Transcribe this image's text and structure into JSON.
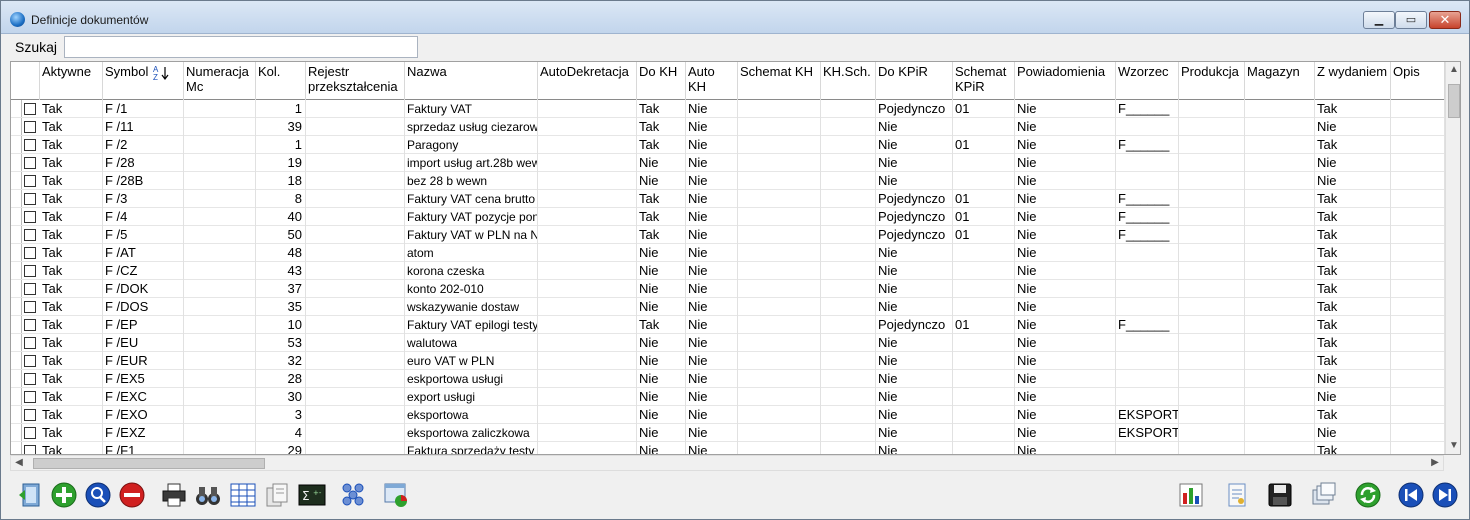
{
  "window": {
    "title": "Definicje dokumentów"
  },
  "search": {
    "label": "Szukaj",
    "value": ""
  },
  "columns": [
    "Aktywne",
    "Symbol",
    "Numeracja Mc",
    "Kol.",
    "Rejestr przekształcenia",
    "Nazwa",
    "AutoDekretacja",
    "Do KH",
    "Auto KH",
    "Schemat KH",
    "KH.Sch.",
    "Do KPiR",
    "Schemat KPiR",
    "Powiadomienia",
    "Wzorzec",
    "Produkcja",
    "Magazyn",
    "Z wydaniem",
    "Opis"
  ],
  "rows": [
    {
      "aktywne": "Tak",
      "symbol": "F /1",
      "kol": "1",
      "nazwa": "Faktury VAT",
      "dokh": "Tak",
      "autokh": "Nie",
      "dokpir": "Pojedynczo",
      "schkpir": "01",
      "pow": "Nie",
      "wzorzec": "F______",
      "zwyd": "Tak"
    },
    {
      "aktywne": "Tak",
      "symbol": "F /11",
      "kol": "39",
      "nazwa": "sprzedaz usług ciezarow",
      "dokh": "Tak",
      "autokh": "Nie",
      "dokpir": "Nie",
      "schkpir": "",
      "pow": "Nie",
      "wzorzec": "",
      "zwyd": "Nie"
    },
    {
      "aktywne": "Tak",
      "symbol": "F /2",
      "kol": "1",
      "nazwa": "Paragony",
      "dokh": "Tak",
      "autokh": "Nie",
      "dokpir": "Nie",
      "schkpir": "01",
      "pow": "Nie",
      "wzorzec": "F______",
      "zwyd": "Tak"
    },
    {
      "aktywne": "Tak",
      "symbol": "F /28",
      "kol": "19",
      "nazwa": "import usług art.28b wew",
      "dokh": "Nie",
      "autokh": "Nie",
      "dokpir": "Nie",
      "schkpir": "",
      "pow": "Nie",
      "wzorzec": "",
      "zwyd": "Nie"
    },
    {
      "aktywne": "Tak",
      "symbol": "F /28B",
      "kol": "18",
      "nazwa": "bez 28 b wewn",
      "dokh": "Nie",
      "autokh": "Nie",
      "dokpir": "Nie",
      "schkpir": "",
      "pow": "Nie",
      "wzorzec": "",
      "zwyd": "Nie"
    },
    {
      "aktywne": "Tak",
      "symbol": "F /3",
      "kol": "8",
      "nazwa": "Faktury VAT cena brutto",
      "dokh": "Tak",
      "autokh": "Nie",
      "dokpir": "Pojedynczo",
      "schkpir": "01",
      "pow": "Nie",
      "wzorzec": "F______",
      "zwyd": "Tak"
    },
    {
      "aktywne": "Tak",
      "symbol": "F /4",
      "kol": "40",
      "nazwa": "Faktury VAT pozycje pon",
      "dokh": "Tak",
      "autokh": "Nie",
      "dokpir": "Pojedynczo",
      "schkpir": "01",
      "pow": "Nie",
      "wzorzec": "F______",
      "zwyd": "Tak"
    },
    {
      "aktywne": "Tak",
      "symbol": "F /5",
      "kol": "50",
      "nazwa": "Faktury VAT w PLN na N",
      "dokh": "Tak",
      "autokh": "Nie",
      "dokpir": "Pojedynczo",
      "schkpir": "01",
      "pow": "Nie",
      "wzorzec": "F______",
      "zwyd": "Tak"
    },
    {
      "aktywne": "Tak",
      "symbol": "F /AT",
      "kol": "48",
      "nazwa": "atom",
      "dokh": "Nie",
      "autokh": "Nie",
      "dokpir": "Nie",
      "schkpir": "",
      "pow": "Nie",
      "wzorzec": "",
      "zwyd": "Tak"
    },
    {
      "aktywne": "Tak",
      "symbol": "F /CZ",
      "kol": "43",
      "nazwa": "korona czeska",
      "dokh": "Nie",
      "autokh": "Nie",
      "dokpir": "Nie",
      "schkpir": "",
      "pow": "Nie",
      "wzorzec": "",
      "zwyd": "Tak"
    },
    {
      "aktywne": "Tak",
      "symbol": "F /DOK",
      "kol": "37",
      "nazwa": "konto 202-010",
      "dokh": "Nie",
      "autokh": "Nie",
      "dokpir": "Nie",
      "schkpir": "",
      "pow": "Nie",
      "wzorzec": "",
      "zwyd": "Tak"
    },
    {
      "aktywne": "Tak",
      "symbol": "F /DOS",
      "kol": "35",
      "nazwa": "wskazywanie dostaw",
      "dokh": "Nie",
      "autokh": "Nie",
      "dokpir": "Nie",
      "schkpir": "",
      "pow": "Nie",
      "wzorzec": "",
      "zwyd": "Tak"
    },
    {
      "aktywne": "Tak",
      "symbol": "F /EP",
      "kol": "10",
      "nazwa": "Faktury VAT epilogi testy",
      "dokh": "Tak",
      "autokh": "Nie",
      "dokpir": "Pojedynczo",
      "schkpir": "01",
      "pow": "Nie",
      "wzorzec": "F______",
      "zwyd": "Tak"
    },
    {
      "aktywne": "Tak",
      "symbol": "F /EU",
      "kol": "53",
      "nazwa": "walutowa",
      "dokh": "Nie",
      "autokh": "Nie",
      "dokpir": "Nie",
      "schkpir": "",
      "pow": "Nie",
      "wzorzec": "",
      "zwyd": "Tak"
    },
    {
      "aktywne": "Tak",
      "symbol": "F /EUR",
      "kol": "32",
      "nazwa": "euro VAT w PLN",
      "dokh": "Nie",
      "autokh": "Nie",
      "dokpir": "Nie",
      "schkpir": "",
      "pow": "Nie",
      "wzorzec": "",
      "zwyd": "Tak"
    },
    {
      "aktywne": "Tak",
      "symbol": "F /EX5",
      "kol": "28",
      "nazwa": "eskportowa usługi",
      "dokh": "Nie",
      "autokh": "Nie",
      "dokpir": "Nie",
      "schkpir": "",
      "pow": "Nie",
      "wzorzec": "",
      "zwyd": "Nie"
    },
    {
      "aktywne": "Tak",
      "symbol": "F /EXC",
      "kol": "30",
      "nazwa": "export usługi",
      "dokh": "Nie",
      "autokh": "Nie",
      "dokpir": "Nie",
      "schkpir": "",
      "pow": "Nie",
      "wzorzec": "",
      "zwyd": "Nie"
    },
    {
      "aktywne": "Tak",
      "symbol": "F /EXO",
      "kol": "3",
      "nazwa": "eksportowa",
      "dokh": "Nie",
      "autokh": "Nie",
      "dokpir": "Nie",
      "schkpir": "",
      "pow": "Nie",
      "wzorzec": "EKSPORT",
      "zwyd": "Tak"
    },
    {
      "aktywne": "Tak",
      "symbol": "F /EXZ",
      "kol": "4",
      "nazwa": "eksportowa zaliczkowa",
      "dokh": "Nie",
      "autokh": "Nie",
      "dokpir": "Nie",
      "schkpir": "",
      "pow": "Nie",
      "wzorzec": "EKSPORT",
      "zwyd": "Nie"
    },
    {
      "aktywne": "Tak",
      "symbol": "F /F1",
      "kol": "29",
      "nazwa": "Faktura sprzedaży testy",
      "dokh": "Nie",
      "autokh": "Nie",
      "dokpir": "Nie",
      "schkpir": "",
      "pow": "Nie",
      "wzorzec": "",
      "zwyd": "Tak"
    }
  ],
  "icons": {
    "sort_ascending": "sort-az-icon",
    "toolbar_left": [
      "exit-icon",
      "add-icon",
      "preview-icon",
      "delete-icon",
      "print-icon",
      "binoculars-icon",
      "filter-grid-icon",
      "documents-icon",
      "formula-icon",
      "hierarchy-icon",
      "window-chart-icon"
    ],
    "toolbar_right": [
      "chart-icon",
      "notes-icon",
      "save-icon",
      "copy-icon",
      "refresh-icon",
      "prev-icon",
      "next-icon"
    ]
  },
  "colors": {
    "green": "#2ea02e",
    "red": "#d02020",
    "blue": "#1a4fb8"
  }
}
